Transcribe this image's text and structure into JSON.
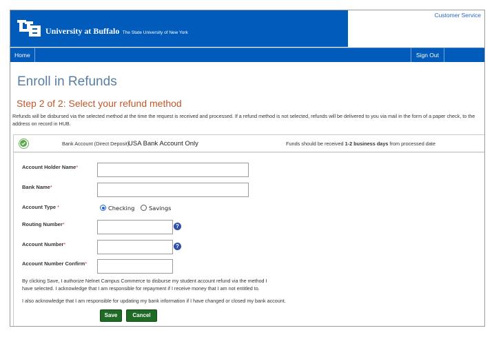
{
  "header": {
    "brand_main": "University at Buffalo",
    "brand_sub": "The State University of New York",
    "customer_service_link": "Customer Service",
    "banner_color": "#005bbb"
  },
  "nav": {
    "home": "Home",
    "sign_out": "Sign Out"
  },
  "page": {
    "title": "Enroll in Refunds",
    "step_title": "Step 2 of 2: Select your refund method",
    "intro": "Refunds will be disbursed via the selected method at the time the request is received and processed. If a refund method is not selected, refunds will be delivered to you via mail in the form of a paper check, to the address on record in HUB."
  },
  "method": {
    "label": "Bank Account (Direct Deposit)",
    "name": "USA Bank Account Only",
    "note_prefix": "Funds should be received ",
    "note_bold": "1-2 business days",
    "note_suffix": " from processed date",
    "icon": "check-circle-icon"
  },
  "form": {
    "account_holder_label": "Account Holder Name",
    "account_holder_value": "",
    "bank_name_label": "Bank Name",
    "bank_name_value": "",
    "account_type_label": "Account Type ",
    "account_type_options": [
      "Checking",
      "Savings"
    ],
    "account_type_selected": "Checking",
    "routing_label": "Routing Number",
    "routing_value": "",
    "account_number_label": "Account Number",
    "account_number_value": "",
    "account_confirm_label": "Account Number Confirm",
    "account_confirm_value": "",
    "required_marker": "*",
    "help_glyph": "?"
  },
  "legal": {
    "authorize": "By clicking Save, I authorize Nelnet Campus Commerce to disburse my student account refund via the method I have selected. I acknowledge that I am responsible for repayment if I receive money that I am not entitled to.",
    "acknowledge": "I also acknowledge that I am responsible for updating my bank information if I have changed or closed my bank account."
  },
  "actions": {
    "save": "Save",
    "cancel": "Cancel"
  }
}
